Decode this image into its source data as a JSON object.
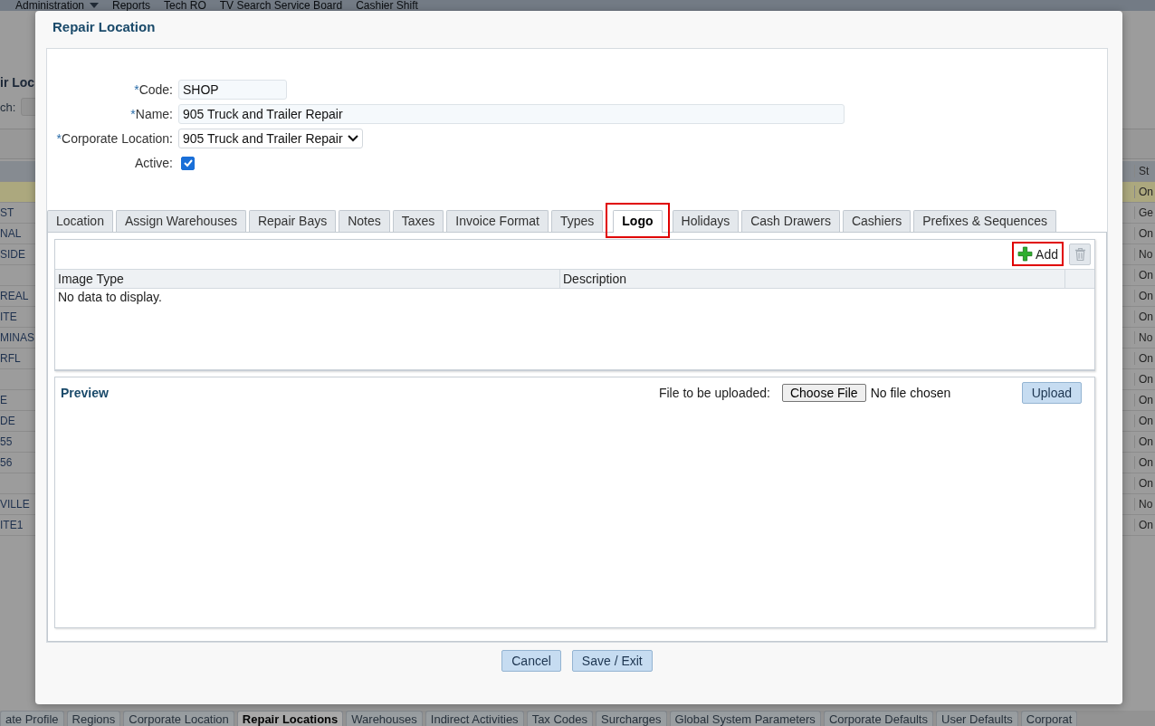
{
  "background": {
    "menu": [
      {
        "label": "Administration",
        "has_menu": true
      },
      {
        "label": "Reports",
        "has_menu": false
      },
      {
        "label": "Tech RO",
        "has_menu": false
      },
      {
        "label": "TV Search Service Board",
        "has_menu": false
      },
      {
        "label": "Cashier Shift",
        "has_menu": false
      }
    ],
    "page_title": "ir Loc",
    "search_label": "ch:",
    "table": {
      "column_2_header": "St",
      "rows": [
        {
          "column_2": "On",
          "selected": true
        },
        {
          "column_1": "ST",
          "column_2": "Ge",
          "selected": false
        },
        {
          "column_1": "NAL",
          "column_2": "On",
          "selected": false
        },
        {
          "column_1": "SIDE",
          "column_2": "No",
          "selected": false
        },
        {
          "column_2": "On",
          "selected": false
        },
        {
          "column_1": "REAL",
          "column_2": "On",
          "selected": false
        },
        {
          "column_1": "ITE",
          "column_2": "On",
          "selected": false
        },
        {
          "column_1": "MINAS",
          "column_2": "No",
          "selected": false
        },
        {
          "column_1": "RFL",
          "column_2": "On",
          "selected": false
        },
        {
          "column_2": "On",
          "selected": false
        },
        {
          "column_1": "E",
          "column_2": "On",
          "selected": false
        },
        {
          "column_1": "DE",
          "column_2": "On",
          "selected": false
        },
        {
          "column_1": "55",
          "column_2": "On",
          "selected": false
        },
        {
          "column_1": "56",
          "column_2": "On",
          "selected": false
        },
        {
          "column_2": "On",
          "selected": false
        },
        {
          "column_1": "VILLE",
          "column_2": "No",
          "selected": false
        },
        {
          "column_1": "ITE1",
          "column_2": "On",
          "selected": false
        }
      ]
    },
    "bottom_tabs": [
      {
        "label": "ate Profile",
        "selected": false
      },
      {
        "label": "Regions",
        "selected": false
      },
      {
        "label": "Corporate Location",
        "selected": false
      },
      {
        "label": "Repair Locations",
        "selected": true
      },
      {
        "label": "Warehouses",
        "selected": false
      },
      {
        "label": "Indirect Activities",
        "selected": false
      },
      {
        "label": "Tax Codes",
        "selected": false
      },
      {
        "label": "Surcharges",
        "selected": false
      },
      {
        "label": "Global System Parameters",
        "selected": false
      },
      {
        "label": "Corporate Defaults",
        "selected": false
      },
      {
        "label": "User Defaults",
        "selected": false
      },
      {
        "label": "Corporat",
        "selected": false
      }
    ]
  },
  "dialog": {
    "title": "Repair Location",
    "fields": [
      {
        "kind": "text",
        "required_mark": "*",
        "label": "Code:",
        "value": "SHOP"
      },
      {
        "kind": "text",
        "required_mark": "*",
        "label": "Name:",
        "value": "905 Truck and Trailer Repair"
      },
      {
        "kind": "select",
        "required_mark": "*",
        "label": "Corporate Location:",
        "value": "905 Truck and Trailer Repair"
      },
      {
        "kind": "checkbox",
        "label": "Active:",
        "checked": true
      }
    ],
    "tabs": [
      {
        "label": "Location",
        "selected": false,
        "highlighted": false
      },
      {
        "label": "Assign Warehouses",
        "selected": false,
        "highlighted": false
      },
      {
        "label": "Repair Bays",
        "selected": false,
        "highlighted": false
      },
      {
        "label": "Notes",
        "selected": false,
        "highlighted": false
      },
      {
        "label": "Taxes",
        "selected": false,
        "highlighted": false
      },
      {
        "label": "Invoice Format",
        "selected": false,
        "highlighted": false
      },
      {
        "label": "Types",
        "selected": false,
        "highlighted": false
      },
      {
        "label": "Logo",
        "selected": true,
        "highlighted": true
      },
      {
        "label": "Holidays",
        "selected": false,
        "highlighted": false
      },
      {
        "label": "Cash Drawers",
        "selected": false,
        "highlighted": false
      },
      {
        "label": "Cashiers",
        "selected": false,
        "highlighted": false
      },
      {
        "label": "Prefixes & Sequences",
        "selected": false,
        "highlighted": false
      }
    ],
    "grid": {
      "add_button": {
        "label": "Add",
        "highlighted": true
      },
      "delete_button": {
        "disabled": true
      },
      "columns": [
        "Image Type",
        "Description"
      ],
      "empty_message": "No data to display."
    },
    "preview": {
      "title": "Preview",
      "file_label": "File to be uploaded:",
      "choose_button": "Choose File",
      "file_status": "No file chosen",
      "upload_button": "Upload"
    },
    "buttons": [
      "Cancel",
      "Save / Exit"
    ]
  }
}
